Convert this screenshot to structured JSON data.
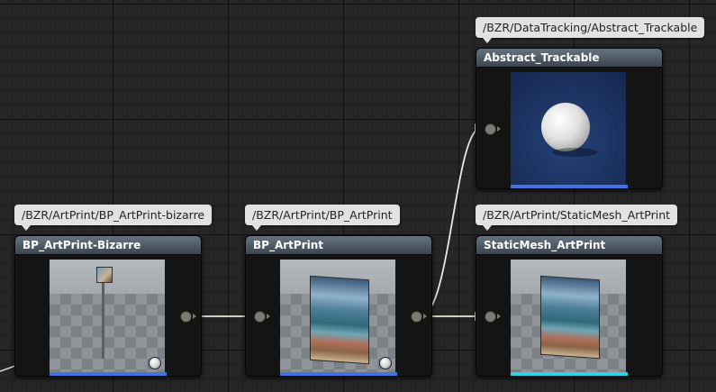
{
  "nodes": [
    {
      "title": "BP_ArtPrint-Bizarre",
      "path": "/BZR/ArtPrint/BP_ArtPrint-bizarre"
    },
    {
      "title": "BP_ArtPrint",
      "path": "/BZR/ArtPrint/BP_ArtPrint"
    },
    {
      "title": "Abstract_Trackable",
      "path": "/BZR/DataTracking/Abstract_Trackable"
    },
    {
      "title": "StaticMesh_ArtPrint",
      "path": "/BZR/ArtPrint/StaticMesh_ArtPrint"
    }
  ],
  "colors": {
    "blueprint_bar": "#3f74e0",
    "mesh_bar": "#2fd2e6",
    "wire": "#e8e8e0",
    "pin": "#7b7b72"
  }
}
